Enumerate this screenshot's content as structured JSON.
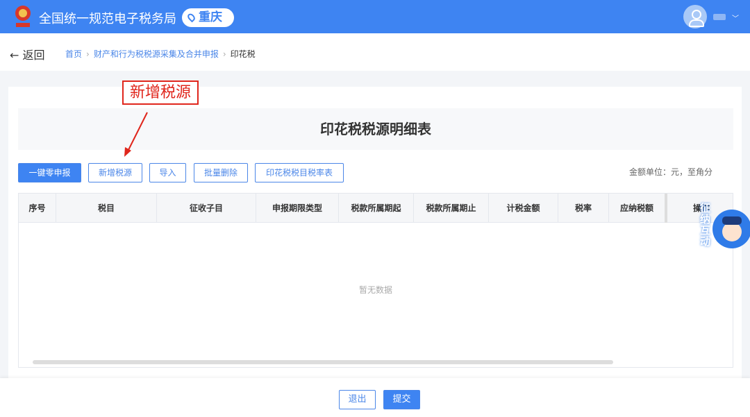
{
  "header": {
    "site_title": "全国统一规范电子税务局",
    "city": "重庆"
  },
  "nav": {
    "back_label": "返回",
    "breadcrumb": [
      "首页",
      "财产和行为税税源采集及合并申报",
      "印花税"
    ]
  },
  "page": {
    "title": "印花税税源明细表",
    "unit_note": "金额单位：元，至角分"
  },
  "toolbar": [
    "一键零申报",
    "新增税源",
    "导入",
    "批量删除",
    "印花税税目税率表"
  ],
  "table": {
    "columns": [
      "序号",
      "税目",
      "征收子目",
      "申报期限类型",
      "税款所属期起",
      "税款所属期止",
      "计税金额",
      "税率",
      "应纳税额",
      "操作"
    ],
    "empty_text": "暂无数据"
  },
  "footer": {
    "exit_label": "退出",
    "submit_label": "提交"
  },
  "annotation": "新增税源",
  "widget": {
    "label": "征纳互动"
  },
  "colors": {
    "primary": "#3e84f2",
    "annotation": "#e0261c"
  }
}
